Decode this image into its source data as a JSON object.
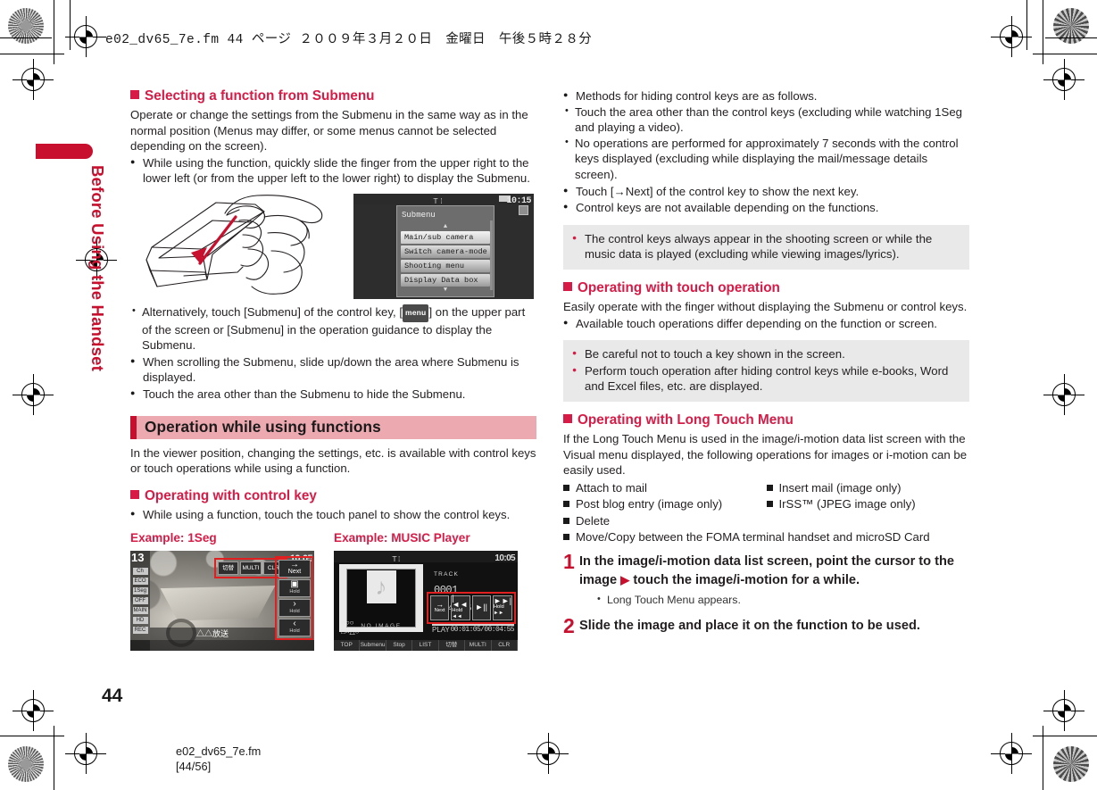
{
  "page_header": "e02_dv65_7e.fm  44 ページ  ２００９年３月２０日　金曜日　午後５時２８分",
  "sidebar": {
    "title": "Before Using the Handset"
  },
  "page_number": "44",
  "footer": {
    "filename": "e02_dv65_7e.fm",
    "pagination": "[44/56]"
  },
  "colors": {
    "accent_red": "#c8102e",
    "heading_red": "#d81b46",
    "band_pink": "#eda9b0",
    "note_gray": "#e9e9e9"
  },
  "left_column": {
    "heading_submenu": "Selecting a function from Submenu",
    "intro": "Operate or change the settings from the Submenu in the same way as in the normal position (Menus may differ, or some menus cannot be selected depending on the screen).",
    "bullet_slide": "While using the function, quickly slide the finger from the upper right to the lower left (or from the upper left to the lower right) to display the Submenu.",
    "sub_bullet_alternatively_pre": "Alternatively, touch [Submenu] of the control key, [",
    "menu_key_label": "menu",
    "sub_bullet_alternatively_post": "] on the upper part of the screen or [Submenu] in the operation guidance to display the Submenu.",
    "bullet_scroll": "When scrolling the Submenu, slide up/down the area where Submenu is displayed.",
    "bullet_hide": "Touch the area other than the Submenu to hide the Submenu.",
    "band_title": "Operation while using functions",
    "band_intro": "In the viewer position, changing the settings, etc. is available with control keys or touch operations while using a function.",
    "heading_control_key": "Operating with control key",
    "bullet_control_key": "While using a function, touch the touch panel to show the control keys.",
    "example_1seg_title": "Example: 1Seg",
    "example_music_title": "Example: MUSIC Player"
  },
  "submenu_screenshot": {
    "title": "Submenu",
    "clock": "10:15",
    "items": [
      "Main/sub camera",
      "Switch camera-mode",
      "Shooting menu",
      "Display Data box"
    ]
  },
  "shot_1seg": {
    "channel": "13",
    "clock": "10:05",
    "left_labels": [
      "Ch",
      "ECO",
      "1Seg",
      "OFF",
      "MAIN",
      "HD",
      "REC"
    ],
    "top_keys": [
      "切替",
      "MULTI",
      "CLR"
    ],
    "side_keys": [
      {
        "icon": "→",
        "label": "Next",
        "hold": ""
      },
      {
        "icon": "▣",
        "label": "",
        "hold": "Hold"
      },
      {
        "icon": "›",
        "label": "",
        "hold": "Hold"
      },
      {
        "icon": "‹",
        "label": "",
        "hold": "Hold"
      }
    ],
    "caption": "△△放送"
  },
  "shot_music": {
    "clock": "10:05",
    "album_placeholder": "NO IMAGE",
    "track_label": "TRACK",
    "track_number": "0001",
    "play_state": "PLAY",
    "timecode": "00:01:05/00:04:55",
    "title_line1": "○○○",
    "title_line2": "□×△○",
    "soft_keys": [
      "TOP",
      "Submenu",
      "Stop",
      "LIST",
      "切替",
      "MULTI",
      "CLR"
    ],
    "control_keys": [
      {
        "icon": "→",
        "label": "Next"
      },
      {
        "icon": "|◄◄",
        "label": "Hold ◄◄"
      },
      {
        "icon": "►||",
        "label": ""
      },
      {
        "icon": "►►|",
        "label": "Hold ►►"
      }
    ]
  },
  "right_column": {
    "bullet_methods": "Methods for hiding control keys are as follows.",
    "sub_bullet_touch_area": "Touch the area other than the control keys (excluding while watching 1Seg and playing a video).",
    "sub_bullet_no_operations": "No operations are performed for approximately 7 seconds with the control keys displayed (excluding while displaying the mail/message details screen).",
    "bullet_next_key": "Touch [→Next] of the control key to show the next key.",
    "bullet_not_available": "Control keys are not available depending on the functions.",
    "note1": [
      "The control keys always appear in the shooting screen or while the music data is played (excluding while viewing images/lyrics)."
    ],
    "heading_touch_operation": "Operating with touch operation",
    "touch_intro": "Easily operate with the finger without displaying the Submenu or control keys.",
    "bullet_touch_differ": "Available touch operations differ depending on the function or screen.",
    "note2": [
      "Be careful not to touch a key shown in the screen.",
      "Perform touch operation after hiding control keys while e-books, Word and Excel files, etc. are displayed."
    ],
    "heading_long_touch": "Operating with Long Touch Menu",
    "long_touch_intro": "If the Long Touch Menu is used in the image/i-motion data list screen with the Visual menu displayed, the following operations for images or i-motion can be easily used.",
    "ops_col1": [
      "Attach to mail",
      "Post blog entry (image only)",
      "Delete"
    ],
    "ops_col2": [
      "Insert mail (image only)",
      "IrSS™ (JPEG image only)"
    ],
    "ops_full": [
      "Move/Copy between the FOMA terminal handset and microSD Card"
    ],
    "steps": [
      {
        "num": "1",
        "text_pre": "In the image/i-motion data list screen, point the cursor to the image",
        "arrow": "▶",
        "text_post": "touch the image/i-motion for a while.",
        "note": "Long Touch Menu appears."
      },
      {
        "num": "2",
        "text_pre": "Slide the image and place it on the function to be used.",
        "arrow": "",
        "text_post": "",
        "note": ""
      }
    ]
  }
}
